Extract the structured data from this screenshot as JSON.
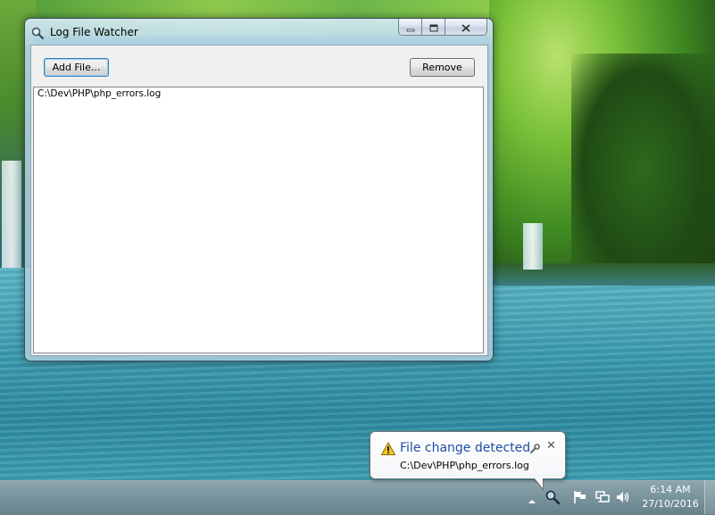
{
  "window": {
    "title": "Log File Watcher",
    "icon": "magnifier-icon"
  },
  "toolbar": {
    "add_label": "Add File...",
    "remove_label": "Remove"
  },
  "file_list": {
    "items": [
      "C:\\Dev\\PHP\\php_errors.log"
    ]
  },
  "notification": {
    "title": "File change detected",
    "message": "C:\\Dev\\PHP\\php_errors.log",
    "icon": "warning-icon",
    "title_color": "#1e4ea6"
  },
  "taskbar": {
    "clock_time": "6:14 AM",
    "clock_date": "27/10/2016",
    "tray_icons": [
      "show-hidden-icons-arrow",
      "magnifier-icon",
      "action-center-flag-icon",
      "network-icon",
      "volume-icon"
    ]
  }
}
